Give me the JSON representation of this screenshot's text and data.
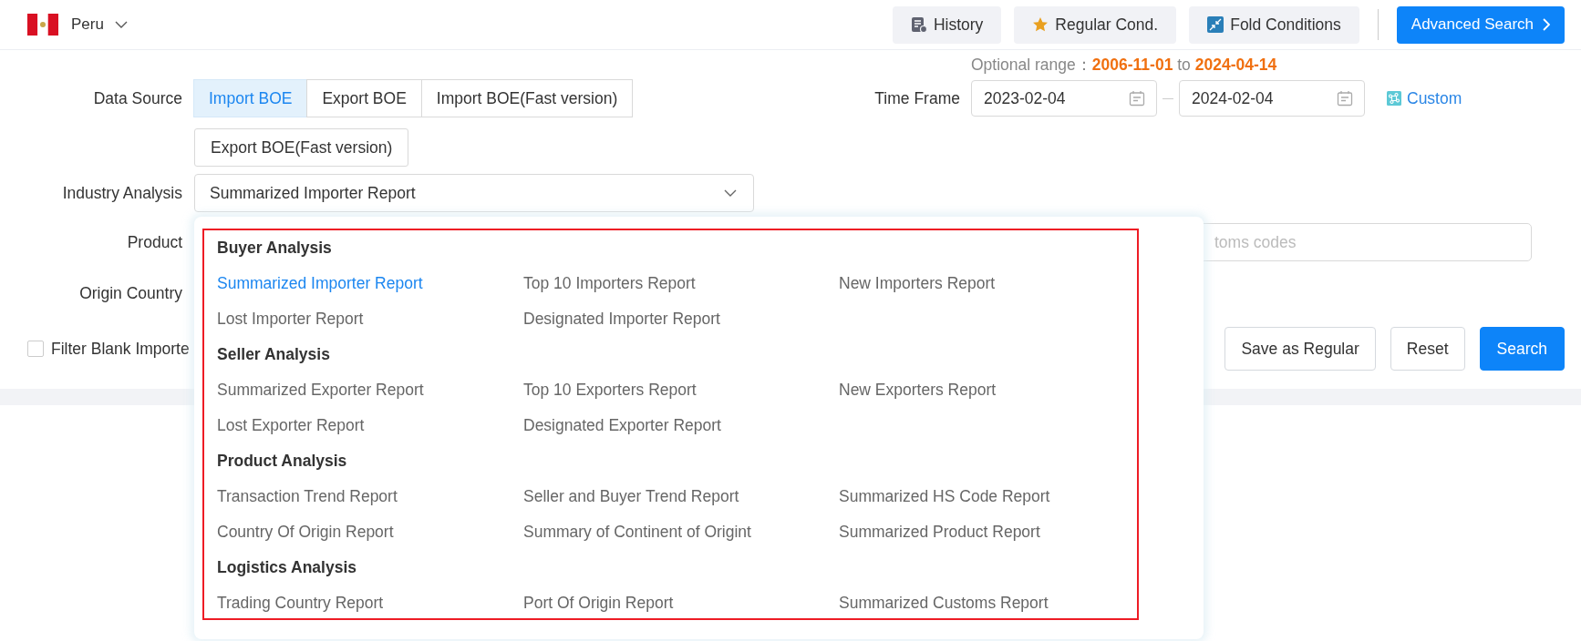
{
  "header": {
    "country": "Peru",
    "buttons": [
      {
        "label": "History",
        "kind": "history"
      },
      {
        "label": "Regular Cond.",
        "kind": "star"
      },
      {
        "label": "Fold Conditions",
        "kind": "fold"
      }
    ],
    "advanced_search": "Advanced Search"
  },
  "optional_range": {
    "label": "Optional range：",
    "from": "2006-11-01",
    "connector": "to",
    "to": "2024-04-14"
  },
  "data_source": {
    "label": "Data Source",
    "options": [
      {
        "label": "Import BOE",
        "selected": true
      },
      {
        "label": "Export BOE",
        "selected": false
      },
      {
        "label": "Import BOE(Fast version)",
        "selected": false
      },
      {
        "label": "Export BOE(Fast version)",
        "selected": false
      }
    ]
  },
  "time_frame": {
    "label": "Time Frame",
    "start": "2023-02-04",
    "end": "2024-02-04",
    "custom": "Custom"
  },
  "industry_analysis": {
    "label": "Industry Analysis",
    "value": "Summarized Importer Report",
    "groups": [
      {
        "title": "Buyer Analysis",
        "items": [
          {
            "label": "Summarized Importer Report",
            "selected": true
          },
          {
            "label": "Top 10 Importers Report",
            "selected": false
          },
          {
            "label": "New Importers Report",
            "selected": false
          },
          {
            "label": "Lost Importer Report",
            "selected": false
          },
          {
            "label": "Designated Importer Report",
            "selected": false
          }
        ]
      },
      {
        "title": "Seller Analysis",
        "items": [
          {
            "label": "Summarized Exporter Report",
            "selected": false
          },
          {
            "label": "Top 10 Exporters Report",
            "selected": false
          },
          {
            "label": "New Exporters Report",
            "selected": false
          },
          {
            "label": "Lost Exporter Report",
            "selected": false
          },
          {
            "label": "Designated Exporter Report",
            "selected": false
          }
        ]
      },
      {
        "title": "Product Analysis",
        "items": [
          {
            "label": "Transaction Trend Report",
            "selected": false
          },
          {
            "label": "Seller and Buyer Trend Report",
            "selected": false
          },
          {
            "label": "Summarized HS Code Report",
            "selected": false
          },
          {
            "label": "Country Of Origin Report",
            "selected": false
          },
          {
            "label": "Summary of Continent of Origint",
            "selected": false
          },
          {
            "label": "Summarized Product Report",
            "selected": false
          }
        ]
      },
      {
        "title": "Logistics Analysis",
        "items": [
          {
            "label": "Trading Country Report",
            "selected": false
          },
          {
            "label": "Port Of Origin Report",
            "selected": false
          },
          {
            "label": "Summarized Customs Report",
            "selected": false
          }
        ]
      }
    ]
  },
  "product": {
    "label": "Product",
    "placeholder": "toms codes"
  },
  "origin_country": {
    "label": "Origin Country"
  },
  "filter_blank": {
    "label": "Filter Blank Importe",
    "checked": false
  },
  "actions": [
    {
      "label": "Save as Regular",
      "kind": "default"
    },
    {
      "label": "Reset",
      "kind": "default"
    },
    {
      "label": "Search",
      "kind": "primary"
    }
  ]
}
